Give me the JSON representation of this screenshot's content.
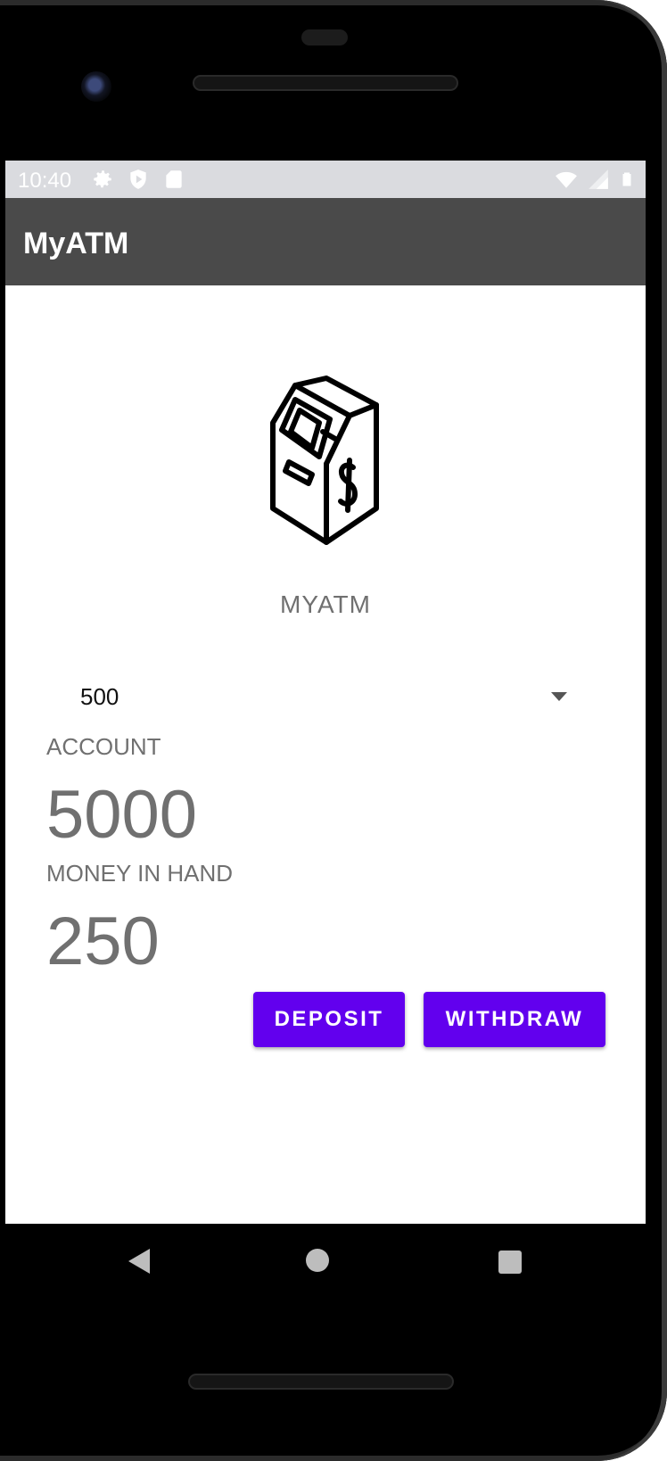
{
  "status_bar": {
    "time": "10:40",
    "icons_left": [
      "gear-icon",
      "play-shield-icon",
      "sd-card-icon"
    ],
    "icons_right": [
      "wifi-icon",
      "signal-icon",
      "battery-icon"
    ]
  },
  "app_bar": {
    "title": "MyATM"
  },
  "logo": {
    "icon": "atm-machine-icon",
    "caption": "MYATM"
  },
  "amount_dropdown": {
    "selected": "500"
  },
  "account": {
    "label": "ACCOUNT",
    "value": "5000"
  },
  "money_in_hand": {
    "label": "MONEY IN HAND",
    "value": "250"
  },
  "buttons": {
    "deposit": "DEPOSIT",
    "withdraw": "WITHDRAW"
  },
  "colors": {
    "accent": "#6200ee",
    "app_bar": "#4a4a4a",
    "status_bar": "#dadbdf",
    "text_secondary": "#707070"
  },
  "nav_bar": [
    "back-icon",
    "home-icon",
    "recents-icon"
  ]
}
